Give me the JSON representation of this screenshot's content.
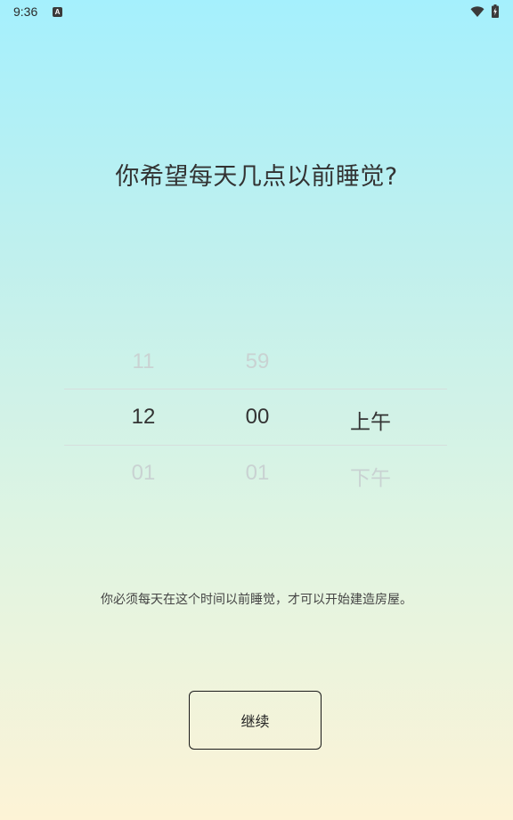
{
  "status_bar": {
    "time": "9:36",
    "app_icon_glyph": "A",
    "icons": [
      "wifi-icon",
      "battery-charging-icon"
    ]
  },
  "title": "你希望每天几点以前睡觉?",
  "picker": {
    "hour": {
      "prev": "11",
      "current": "12",
      "next": "01"
    },
    "minute": {
      "prev": "59",
      "current": "00",
      "next": "01"
    },
    "ampm": {
      "prev": "",
      "current": "上午",
      "next": "下午"
    }
  },
  "description": "你必须每天在这个时间以前睡觉，才可以开始建造房屋。",
  "continue_button": {
    "label": "继续"
  },
  "colors": {
    "gradient_top": "#a5f0fd",
    "gradient_bottom": "#fdf3d6",
    "text": "#333333",
    "faded_text": "#c9d2d2"
  }
}
